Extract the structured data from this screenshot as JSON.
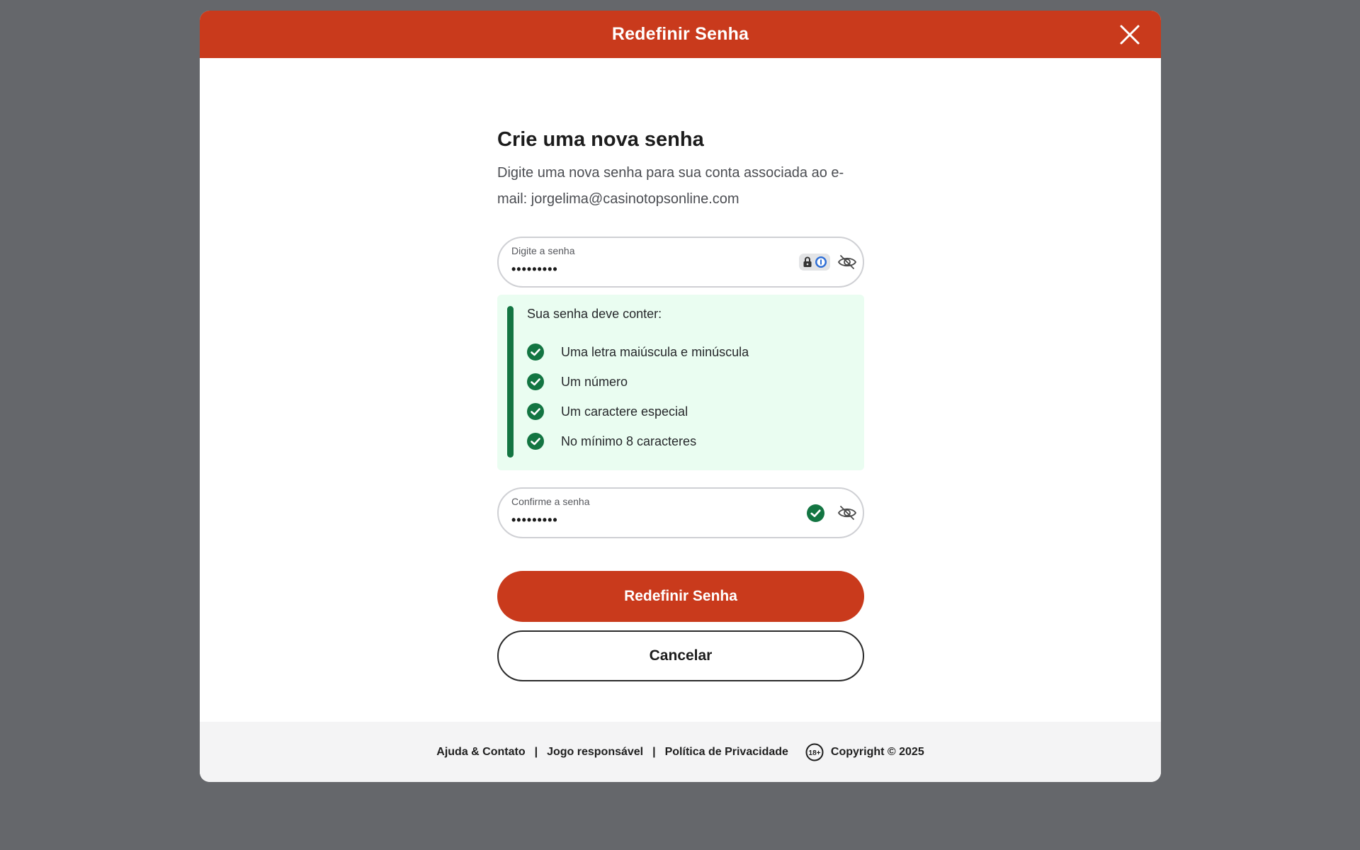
{
  "modal": {
    "title": "Redefinir Senha",
    "close_icon": "close-icon"
  },
  "form": {
    "heading": "Crie uma nova senha",
    "subtitle_line1": "Digite uma nova senha para sua conta associada ao e-",
    "subtitle_line2": "mail: jorgelima@casinotopsonline.com",
    "password": {
      "label": "Digite a senha",
      "value": "•••••••••"
    },
    "requirements": {
      "title": "Sua senha deve conter:",
      "items": [
        {
          "label": "Uma letra maiúscula e minúscula",
          "met": true
        },
        {
          "label": "Um número",
          "met": true
        },
        {
          "label": "Um caractere especial",
          "met": true
        },
        {
          "label": "No mínimo 8 caracteres",
          "met": true
        }
      ]
    },
    "confirm": {
      "label": "Confirme a senha",
      "value": "•••••••••"
    },
    "submit_label": "Redefinir Senha",
    "cancel_label": "Cancelar"
  },
  "footer": {
    "links": [
      "Ajuda & Contato",
      "Jogo responsável",
      "Política de Privacidade"
    ],
    "separator": "|",
    "age_badge": "18+",
    "copyright": "Copyright © 2025"
  },
  "colors": {
    "brand": "#c93a1c",
    "success": "#137542",
    "overlay": "#65676b"
  }
}
